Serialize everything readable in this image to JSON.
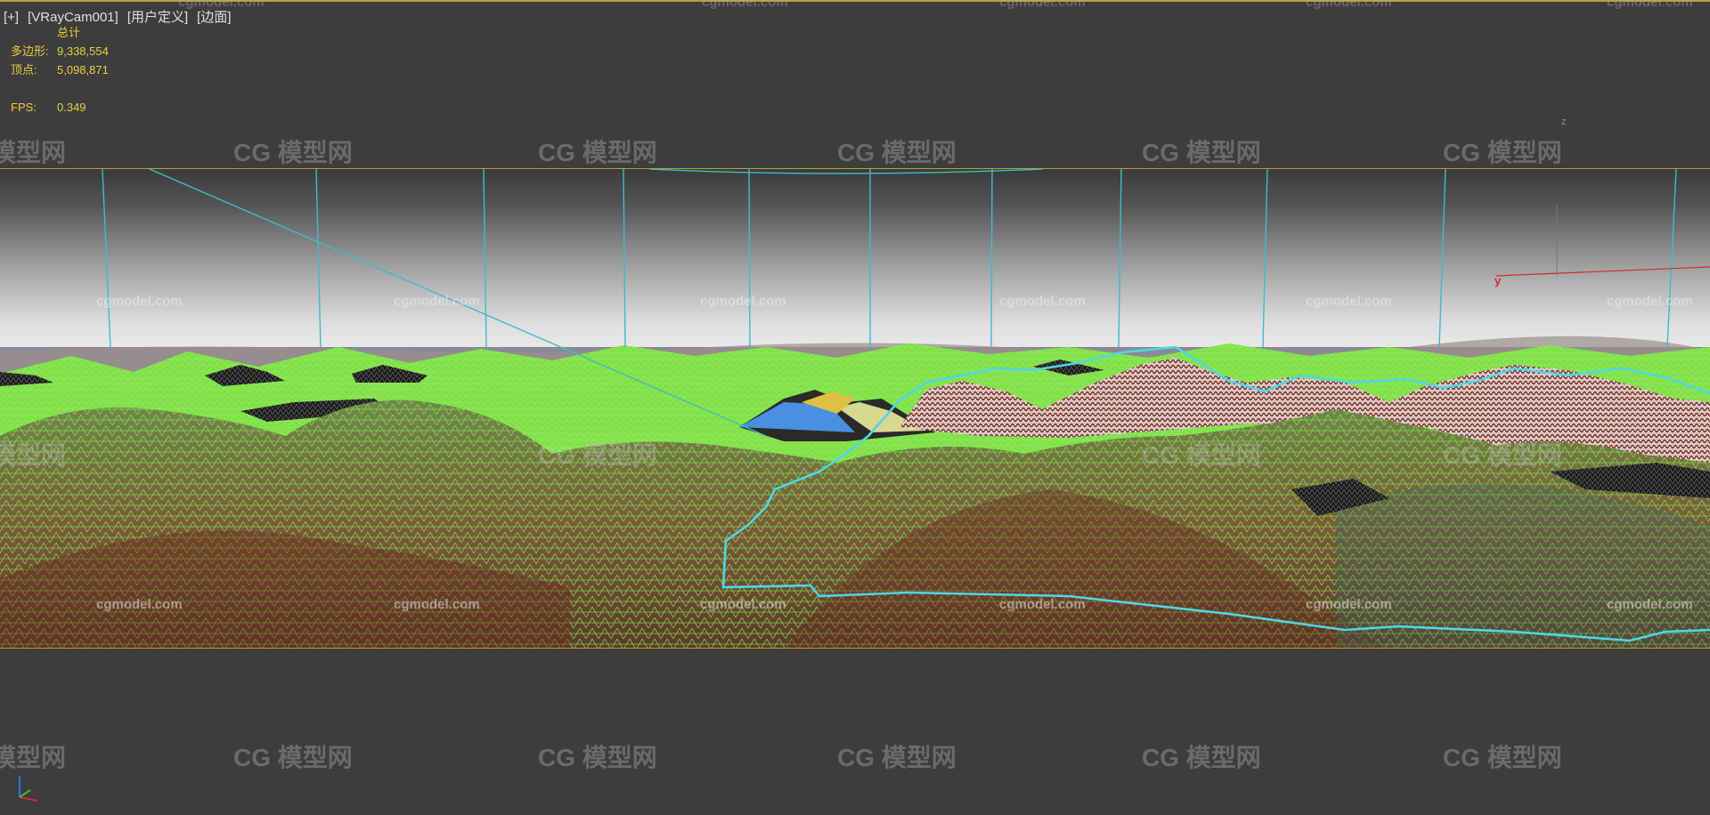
{
  "viewport": {
    "label_parts": [
      "[+]",
      "[VRayCam001]",
      "[用户定义]",
      "[边面]"
    ]
  },
  "stats": {
    "total_label": "总计",
    "polys_label": "多边形:",
    "polys_value": "9,338,554",
    "verts_label": "顶点:",
    "verts_value": "5,098,871",
    "fps_label": "FPS:",
    "fps_value": "0.349"
  },
  "axes": {
    "z_label": "z",
    "y_label": "y"
  },
  "watermarks": {
    "logo_text": "模型网",
    "logo_mark": "CG",
    "site_text": "cgmodel.com"
  },
  "colors": {
    "frame_border": "#b5a13a",
    "stats_text": "#e8d040",
    "wire_green": "#7fe04a",
    "spline_cyan": "#4fd7e8",
    "axis_red": "#c83030"
  }
}
